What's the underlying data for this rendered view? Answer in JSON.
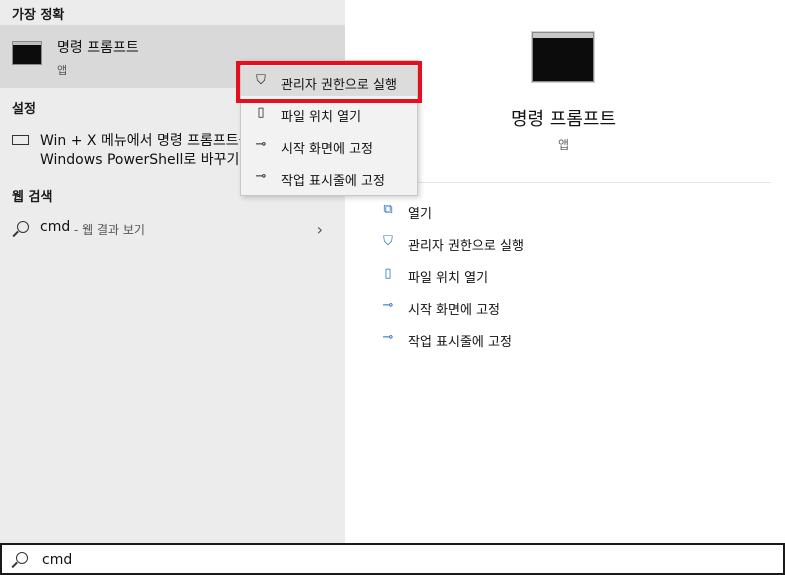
{
  "sections": {
    "best_match": "가장 정확",
    "settings": "설정",
    "web_search": "웹 검색"
  },
  "best_match_item": {
    "title": "명령 프롬프트",
    "subtitle": "앱"
  },
  "settings_item": {
    "line1": "Win + X 메뉴에서 명령 프롬프트를",
    "line2": "Windows PowerShell로 바꾸기"
  },
  "web_item": {
    "query": "cmd",
    "hint": "- 웹 결과 보기"
  },
  "context_menu": [
    {
      "label": "관리자 권한으로 실행",
      "icon": "shield-icon"
    },
    {
      "label": "파일 위치 열기",
      "icon": "file-location-icon"
    },
    {
      "label": "시작 화면에 고정",
      "icon": "pin-icon"
    },
    {
      "label": "작업 표시줄에 고정",
      "icon": "pin-icon"
    }
  ],
  "details": {
    "title": "명령 프롬프트",
    "subtitle": "앱",
    "actions": [
      {
        "label": "열기",
        "icon": "open-icon"
      },
      {
        "label": "관리자 권한으로 실행",
        "icon": "shield-icon"
      },
      {
        "label": "파일 위치 열기",
        "icon": "file-location-icon"
      },
      {
        "label": "시작 화면에 고정",
        "icon": "pin-icon"
      },
      {
        "label": "작업 표시줄에 고정",
        "icon": "pin-icon"
      }
    ]
  },
  "search": {
    "value": "cmd"
  },
  "colors": {
    "accent": "#1f6fc4",
    "highlight_box": "#e3101e"
  }
}
